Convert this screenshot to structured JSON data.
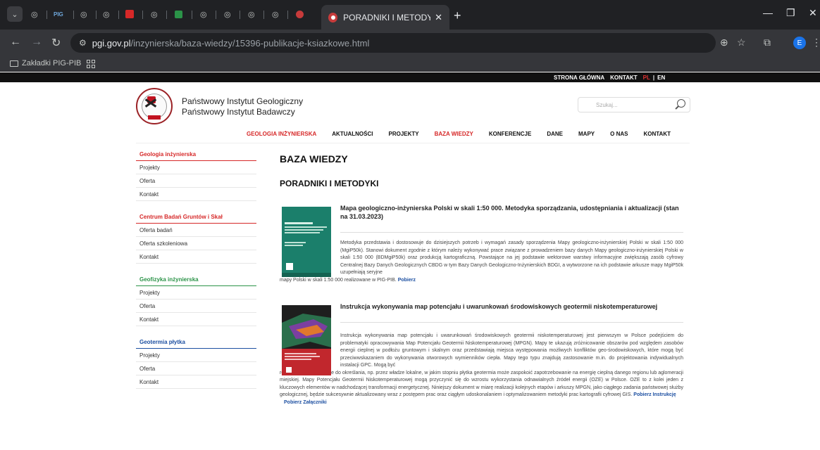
{
  "browser": {
    "active_tab_title": "PORADNIKI I METODYKI - Państ",
    "url_host": "pgi.gov.pl",
    "url_path": "/inzynierska/baza-wiedzy/15396-publikacje-ksiazkowe.html",
    "bookmarks_label": "Zakładki PIG-PIB",
    "profile_initial": "E",
    "pinned_tab_label": "PIG"
  },
  "topmenu": {
    "home": "STRONA GŁÓWNA",
    "contact": "KONTAKT",
    "lang_pl": "PL",
    "separator": "|",
    "lang_en": "EN"
  },
  "header": {
    "institute_line1": "Państwowy Instytut Geologiczny",
    "institute_line2": "Państwowy Instytut Badawczy",
    "search_placeholder": "Szukaj..."
  },
  "mainnav": [
    {
      "label": "GEOLOGIA INŻYNIERSKA",
      "active": true
    },
    {
      "label": "AKTUALNOŚCI",
      "active": false
    },
    {
      "label": "PROJEKTY",
      "active": false
    },
    {
      "label": "BAZA WIEDZY",
      "active": true
    },
    {
      "label": "KONFERENCJE",
      "active": false
    },
    {
      "label": "DANE",
      "active": false
    },
    {
      "label": "MAPY",
      "active": false
    },
    {
      "label": "O NAS",
      "active": false
    },
    {
      "label": "KONTAKT",
      "active": false
    }
  ],
  "sidebar": [
    {
      "title": "Geologia inżynierska",
      "color": "#d62828",
      "items": [
        "Projekty",
        "Oferta",
        "Kontakt"
      ]
    },
    {
      "title": "Centrum Badań Gruntów i Skał",
      "color": "#d62828",
      "items": [
        "Oferta badań",
        "Oferta szkoleniowa",
        "Kontakt"
      ]
    },
    {
      "title": "Geofizyka inżynierska",
      "color": "#2b9348",
      "items": [
        "Projekty",
        "Oferta",
        "Kontakt"
      ]
    },
    {
      "title": "Geotermia płytka",
      "color": "#1c4fa1",
      "items": [
        "Projekty",
        "Oferta",
        "Kontakt"
      ]
    }
  ],
  "content": {
    "heading": "BAZA WIEDZY",
    "subheading": "PORADNIKI I METODYKI",
    "publications": [
      {
        "title": "Mapa geologiczno-inżynierska Polski w skali 1:50 000. Metodyka sporządzania, udostępniania i aktualizacji (stan na 31.03.2023)",
        "desc_first": "Metodyka przedstawia i dostosowuje do dzisiejszych potrzeb i wymagań zasady sporządzenia Mapy geologiczno-inżynierskiej Polski w skali 1:50 000 (MgiP50k). Stanowi dokument zgodnie z którym należy wykonywać prace związane z prowadzeniem bazy danych Mapy geologiczno-inżynierskiej Polski w skali 1:50 000 (BDMgiP50k) oraz produkcją kartograficzną. Powstające na jej podstawie wektorowe warstwy informacyjne zwiększają zasób cyfrowy Centralnej Bazy Danych Geologicznych CBDG w tym Bazy Danych Geologiczno-Inżynierskich BDGI, a wytworzone na ich podstawie arkusze mapy MgiP50k uzupełniają seryjne",
        "desc_rest": "mapy Polski w skali 1:50 000 realizowane w PIG-PIB.",
        "links": [
          "Pobierz"
        ],
        "cover_color": "#1b7f6b"
      },
      {
        "title": "Instrukcja wykonywania map potencjału i uwarunkowań środowiskowych geotermii niskotemperaturowej",
        "desc_first": "Instrukcja wykonywania map potencjału i uwarunkowań środowiskowych geotermii niskotemperaturowej jest pierwszym w Polsce podejściem do problematyki opracowywania Map Potencjału Geotermii Niskotemperaturowej (MPGN). Mapy te ukazują zróżnicowanie obszarów pod względem zasobów energii cieplnej w podłożu gruntowym i skalnym oraz przedstawiają miejsca występowania możliwych konfliktów geo-środowiskowych, które mogą być przeciwwskazaniem do wykonywania otworowych wymienników ciepła. Mapy tego typu znajdują zastosowanie m.in. do projektowania indywidualnych instalacji GPC. Mogą być",
        "desc_rest": "również wykorzystywane do określania, np. przez władze lokalne, w jakim stopniu płytka geotermia może zaspokoić zapotrzebowanie na energię cieplną danego regionu lub aglomeracji miejskiej. Mapy Potencjału Geotermii Niskotemperaturowej mogą przyczynić się do wzrostu wykorzystania odnawialnych źródeł energii (OZE) w Polsce. OZE to z kolei jeden z kluczowych elementów w nadchodzącej transformacji energetycznej. Niniejszy dokument w miarę realizacji kolejnych etapów i arkuszy MPGN, jako ciągłego zadania państwowej służby geologicznej, będzie sukcesywnie aktualizowany wraz z postępem prac oraz ciągłym udoskonalaniem i optymalizowaniem metodyki prac kartografii cyfrowej GIS.",
        "links": [
          "Pobierz Instrukcję",
          "Pobierz Załączniki"
        ],
        "cover_color": "#c1272d"
      }
    ]
  }
}
